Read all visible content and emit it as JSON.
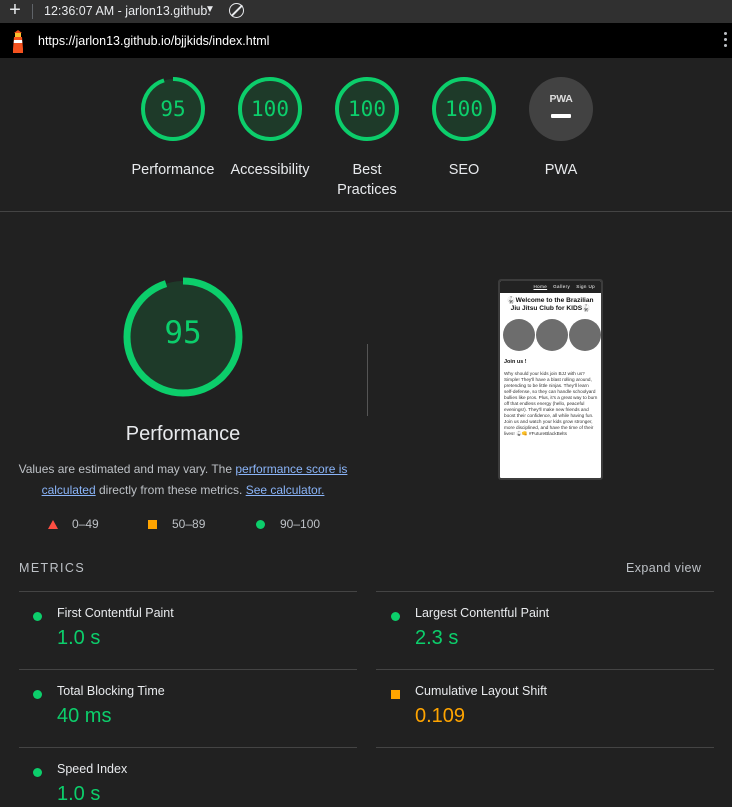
{
  "toolbar": {
    "tab_title": "12:36:07 AM - jarlon13.github.",
    "url": "https://jarlon13.github.io/bjjkids/index.html"
  },
  "colors": {
    "pass": "#0cce6b",
    "average": "#ffa400",
    "fail": "#ff4e42",
    "background": "#212121"
  },
  "gauges": [
    {
      "score": "95",
      "label": "Performance",
      "fraction": 0.95
    },
    {
      "score": "100",
      "label": "Accessibility",
      "fraction": 1.0
    },
    {
      "score": "100",
      "label": "Best Practices",
      "label_line1": "Best",
      "label_line2": "Practices",
      "fraction": 1.0
    },
    {
      "score": "100",
      "label": "SEO",
      "fraction": 1.0
    }
  ],
  "pwa": {
    "badge": "PWA",
    "label": "PWA"
  },
  "performance": {
    "score": "95",
    "fraction": 0.95,
    "title": "Performance",
    "note_prefix": "Values are estimated and may vary. The ",
    "note_link1": "performance score is calculated",
    "note_middle": " directly from these metrics. ",
    "note_link2": "See calculator."
  },
  "legend": [
    {
      "icon": "triangle-icon",
      "range": "0–49"
    },
    {
      "icon": "square-icon",
      "range": "50–89"
    },
    {
      "icon": "circle-icon",
      "range": "90–100"
    }
  ],
  "thumbnail": {
    "nav": [
      "Home",
      "Gallery",
      "Sign Up"
    ],
    "title": "🥋Welcome to the Brazilian Jiu Jitsu Club for KIDS🥋",
    "join": "Join us !",
    "body": "Why should your kids join BJJ with us? Simple! They'll have a blast rolling around, pretending to be little ninjas. They'll learn self-defense, so they can handle schoolyard bullies like pros. Plus, it's a great way to burn off that endless energy (hello, peaceful evenings!). They'll make new friends and boost their confidence, all while having fun. Join us and watch your kids grow stronger, more disciplined, and have the time of their lives! 🥋👊 #FutureBlackBelts"
  },
  "metrics": {
    "heading": "METRICS",
    "expand": "Expand view",
    "items": [
      {
        "name": "First Contentful Paint",
        "value": "1.0 s",
        "status": "pass"
      },
      {
        "name": "Largest Contentful Paint",
        "value": "2.3 s",
        "status": "pass"
      },
      {
        "name": "Total Blocking Time",
        "value": "40 ms",
        "status": "pass"
      },
      {
        "name": "Cumulative Layout Shift",
        "value": "0.109",
        "status": "average"
      },
      {
        "name": "Speed Index",
        "value": "1.0 s",
        "status": "pass"
      }
    ]
  }
}
